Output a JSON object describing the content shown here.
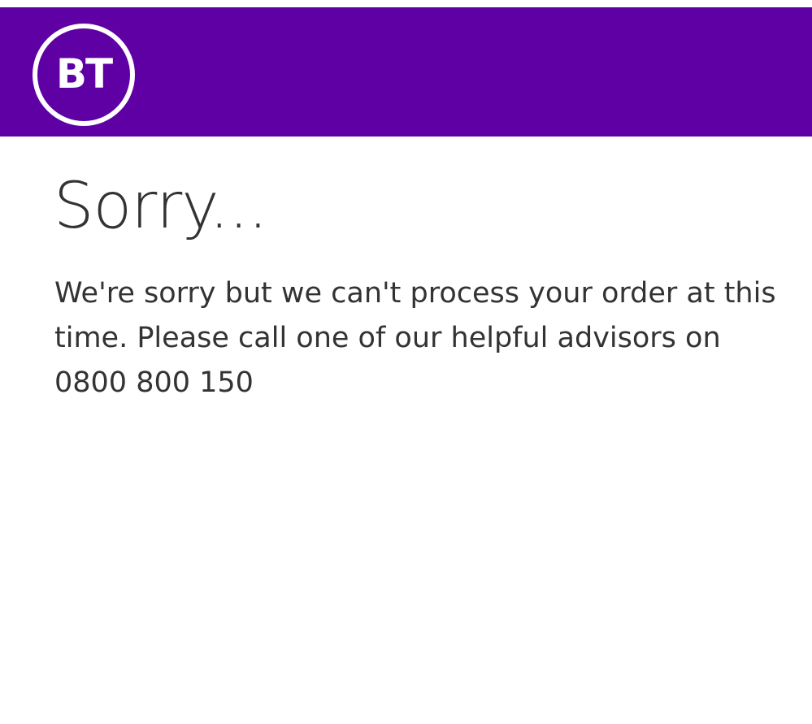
{
  "header": {
    "logo_text": "BT",
    "background_color": "#5f00a5"
  },
  "main": {
    "title": "Sorry...",
    "message": "We're sorry but we can't process your order at this time. Please call one of our helpful advisors on 0800 800 150"
  }
}
